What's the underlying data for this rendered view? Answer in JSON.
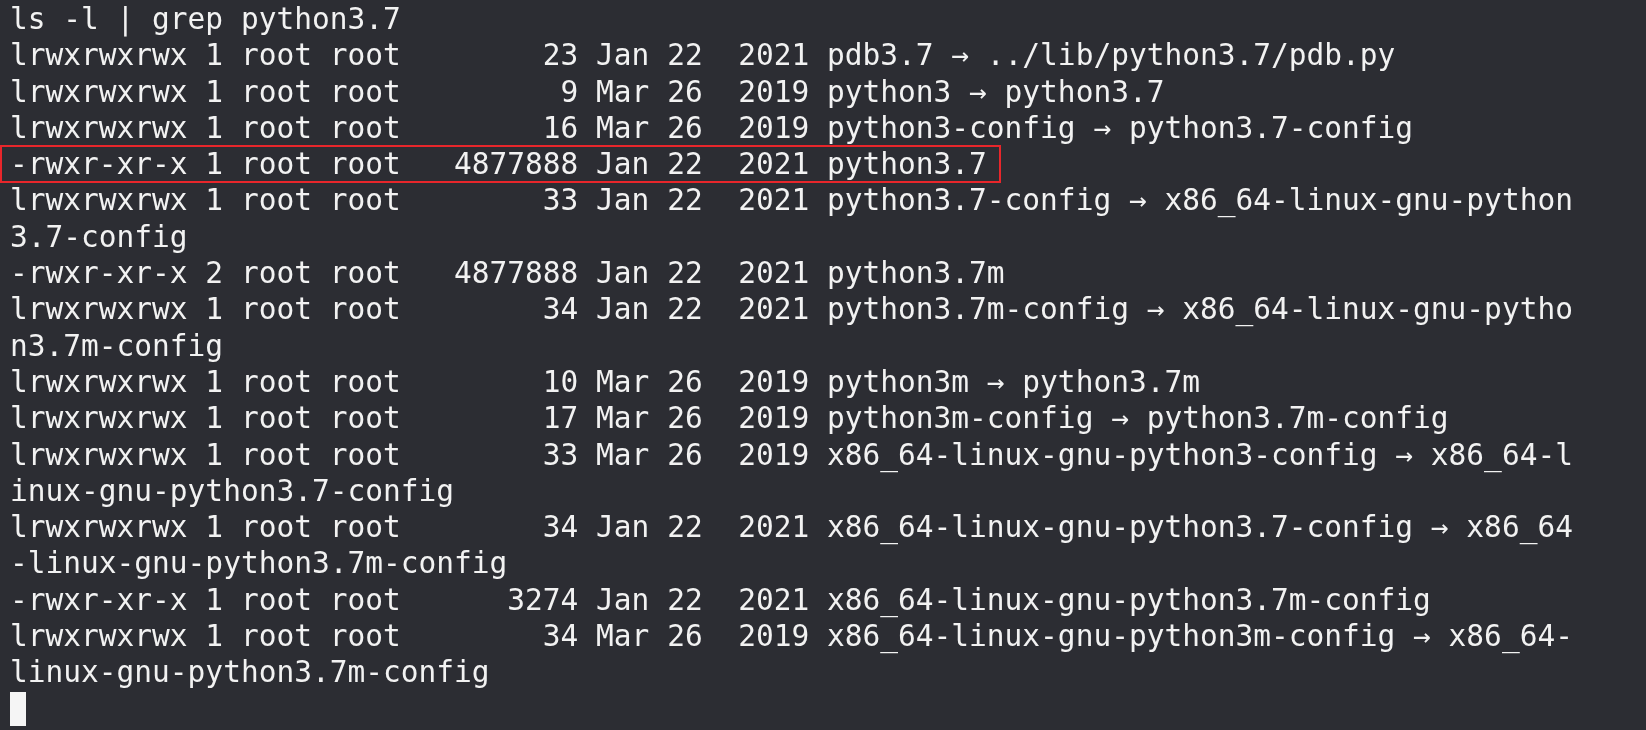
{
  "terminal": {
    "lines": [
      {
        "text": "ls -l | grep python3.7",
        "highlighted": false
      },
      {
        "text": "lrwxrwxrwx 1 root root        23 Jan 22  2021 pdb3.7 → ../lib/python3.7/pdb.py",
        "highlighted": false
      },
      {
        "text": "lrwxrwxrwx 1 root root         9 Mar 26  2019 python3 → python3.7",
        "highlighted": false
      },
      {
        "text": "lrwxrwxrwx 1 root root        16 Mar 26  2019 python3-config → python3.7-config",
        "highlighted": false
      },
      {
        "text": "-rwxr-xr-x 1 root root   4877888 Jan 22  2021 python3.7",
        "highlighted": true
      },
      {
        "text": "lrwxrwxrwx 1 root root        33 Jan 22  2021 python3.7-config → x86_64-linux-gnu-python",
        "highlighted": false
      },
      {
        "text": "3.7-config",
        "highlighted": false
      },
      {
        "text": "-rwxr-xr-x 2 root root   4877888 Jan 22  2021 python3.7m",
        "highlighted": false
      },
      {
        "text": "lrwxrwxrwx 1 root root        34 Jan 22  2021 python3.7m-config → x86_64-linux-gnu-pytho",
        "highlighted": false
      },
      {
        "text": "n3.7m-config",
        "highlighted": false
      },
      {
        "text": "lrwxrwxrwx 1 root root        10 Mar 26  2019 python3m → python3.7m",
        "highlighted": false
      },
      {
        "text": "lrwxrwxrwx 1 root root        17 Mar 26  2019 python3m-config → python3.7m-config",
        "highlighted": false
      },
      {
        "text": "lrwxrwxrwx 1 root root        33 Mar 26  2019 x86_64-linux-gnu-python3-config → x86_64-l",
        "highlighted": false
      },
      {
        "text": "inux-gnu-python3.7-config",
        "highlighted": false
      },
      {
        "text": "lrwxrwxrwx 1 root root        34 Jan 22  2021 x86_64-linux-gnu-python3.7-config → x86_64",
        "highlighted": false
      },
      {
        "text": "-linux-gnu-python3.7m-config",
        "highlighted": false
      },
      {
        "text": "-rwxr-xr-x 1 root root      3274 Jan 22  2021 x86_64-linux-gnu-python3.7m-config",
        "highlighted": false
      },
      {
        "text": "lrwxrwxrwx 1 root root        34 Mar 26  2019 x86_64-linux-gnu-python3m-config → x86_64-",
        "highlighted": false
      },
      {
        "text": "linux-gnu-python3.7m-config",
        "highlighted": false
      }
    ]
  }
}
